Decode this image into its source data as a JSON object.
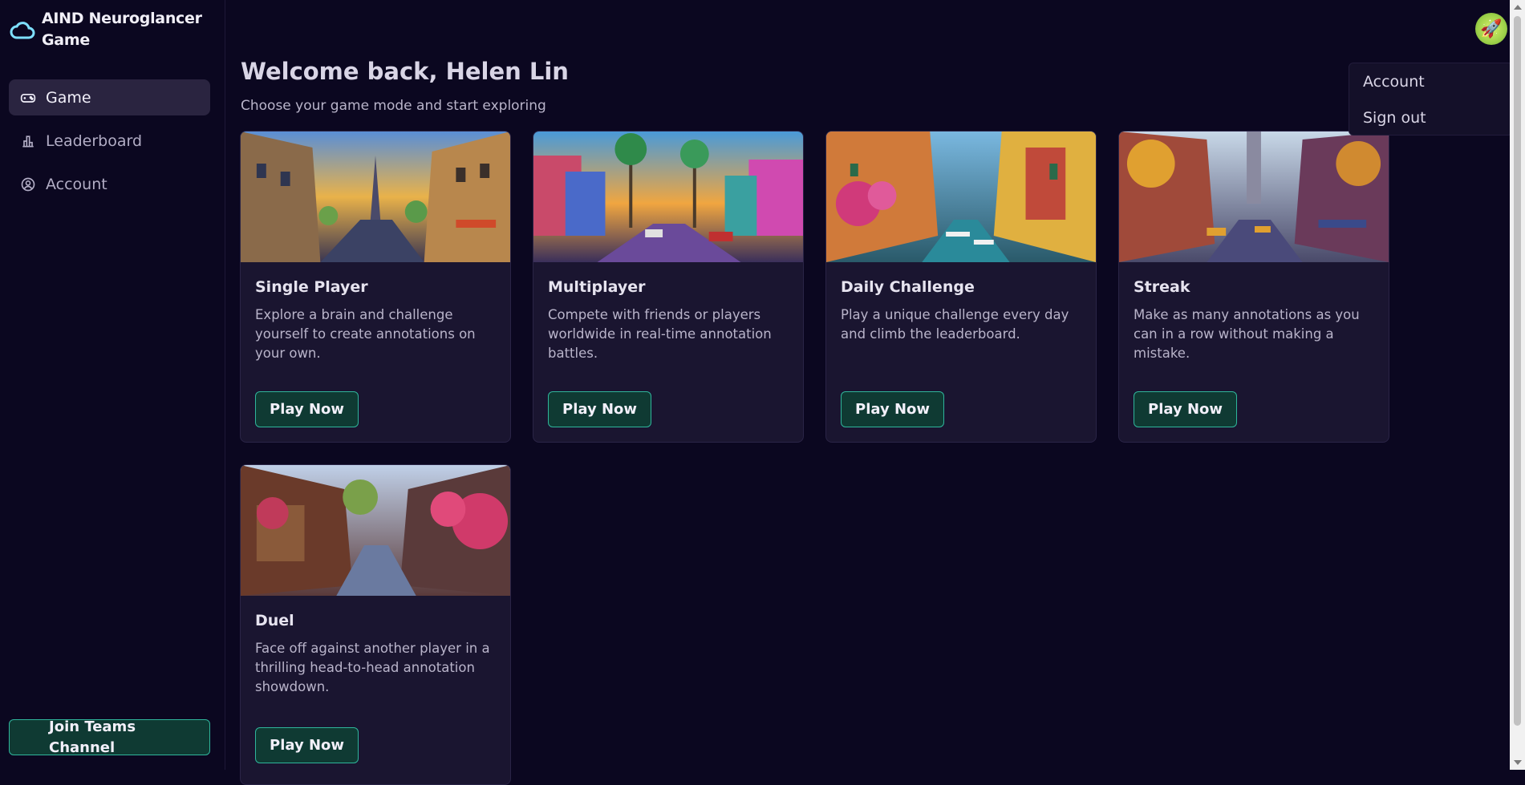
{
  "app": {
    "title": "AIND Neuroglancer Game"
  },
  "sidebar": {
    "items": [
      {
        "label": "Game",
        "icon": "gamepad-icon",
        "active": true
      },
      {
        "label": "Leaderboard",
        "icon": "bar-chart-icon",
        "active": false
      },
      {
        "label": "Account",
        "icon": "user-circle-icon",
        "active": false
      }
    ],
    "teams_button": "Join Teams Channel"
  },
  "main": {
    "welcome": "Welcome back, Helen Lin",
    "subtitle": "Choose your game mode and start exploring",
    "cards": [
      {
        "title": "Single Player",
        "description": "Explore a brain and challenge yourself to create annotations on your own.",
        "button": "Play Now",
        "art": "paris-street-painting"
      },
      {
        "title": "Multiplayer",
        "description": "Compete with friends or players worldwide in real-time annotation battles.",
        "button": "Play Now",
        "art": "palm-street-painting"
      },
      {
        "title": "Daily Challenge",
        "description": "Play a unique challenge every day and climb the leaderboard.",
        "button": "Play Now",
        "art": "venice-canal-painting"
      },
      {
        "title": "Streak",
        "description": "Make as many annotations as you can in a row without making a mistake.",
        "button": "Play Now",
        "art": "city-street-painting"
      },
      {
        "title": "Duel",
        "description": "Face off against another player in a thrilling head-to-head annotation showdown.",
        "button": "Play Now",
        "art": "japanese-alley-painting"
      }
    ]
  },
  "user_menu": {
    "avatar_icon": "rocket-icon",
    "items": [
      "Account",
      "Sign out"
    ]
  },
  "colors": {
    "background": "#0b0720",
    "card": "#1a1530",
    "button": "#0f3a33",
    "button_border": "#2fb59b",
    "active_nav": "#2a2440"
  }
}
